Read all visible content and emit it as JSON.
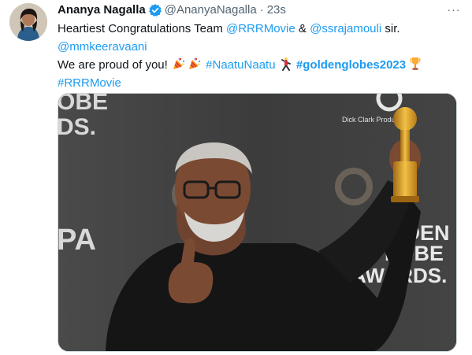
{
  "tweet": {
    "author_name": "Ananya Nagalla",
    "author_handle": "@AnanyaNagalla",
    "separator": "·",
    "timestamp": "23s",
    "more_label": "···",
    "line1": {
      "prefix": "Heartiest Congratulations Team ",
      "mention1": "@RRRMovie",
      "middle": " & ",
      "mention2": "@ssrajamouli",
      "suffix": " sir."
    },
    "line2": {
      "mention": "@mmkeeravaani"
    },
    "line3": {
      "prefix": "We are proud of you! ",
      "hashtag1": "#NaatuNaatu",
      "hashtag2": "#goldenglobes2023"
    },
    "line4": {
      "hashtag": "#RRRMovie"
    }
  },
  "media": {
    "backdrop_text_left_top": "OBE",
    "backdrop_text_left_mid": "DS.",
    "backdrop_text_left_bottom": "PA",
    "backdrop_brand": "Dick Clark Produ",
    "backdrop_logo_line1": "OLDEN",
    "backdrop_logo_line2": "LOBE",
    "backdrop_logo_line3": "AWARDS."
  },
  "icons": [
    "verified-badge-icon",
    "party-popper-icon",
    "dancer-icon",
    "trophy-icon",
    "more-options-icon"
  ],
  "colors": {
    "link": "#1d9bf0",
    "secondary_text": "#536471",
    "text": "#0f1419"
  }
}
